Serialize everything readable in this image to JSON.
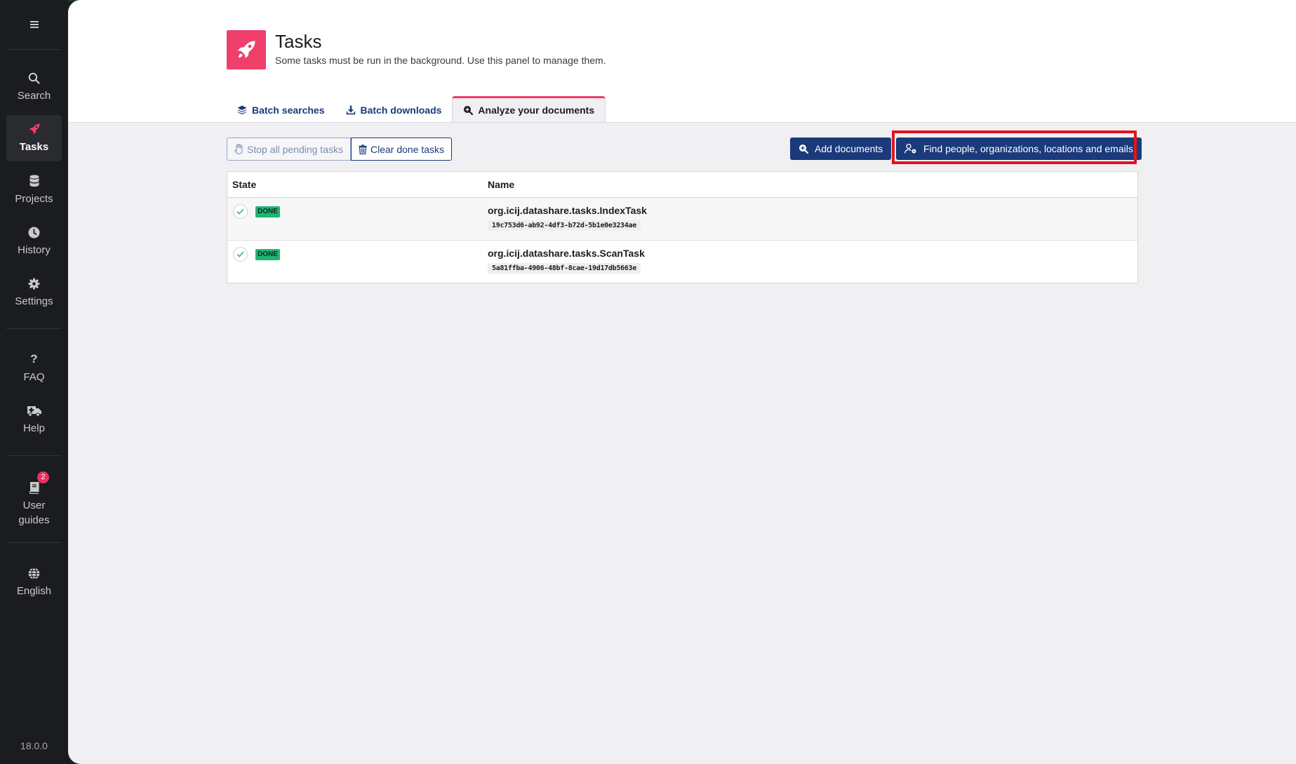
{
  "sidebar": {
    "menu_icon": "hamburger-icon",
    "items": [
      {
        "label": "Search",
        "icon": "search-icon"
      },
      {
        "label": "Tasks",
        "icon": "rocket-icon",
        "active": true
      },
      {
        "label": "Projects",
        "icon": "database-icon"
      },
      {
        "label": "History",
        "icon": "clock-icon"
      },
      {
        "label": "Settings",
        "icon": "gear-icon"
      },
      {
        "label": "FAQ",
        "icon": "question-icon"
      },
      {
        "label": "Help",
        "icon": "ambulance-icon"
      },
      {
        "label": "User guides",
        "icon": "book-icon",
        "badge": "2"
      },
      {
        "label": "English",
        "icon": "globe-icon"
      }
    ],
    "version": "18.0.0"
  },
  "header": {
    "title": "Tasks",
    "subtitle": "Some tasks must be run in the background. Use this panel to manage them."
  },
  "tabs": [
    {
      "label": "Batch searches",
      "icon": "layers-icon"
    },
    {
      "label": "Batch downloads",
      "icon": "download-icon"
    },
    {
      "label": "Analyze your documents",
      "icon": "search-plus-icon",
      "active": true
    }
  ],
  "toolbar": {
    "stop_label": "Stop all pending tasks",
    "clear_label": "Clear done tasks",
    "add_label": "Add documents",
    "find_label": "Find people, organizations, locations and emails"
  },
  "table": {
    "headers": {
      "state": "State",
      "name": "Name"
    },
    "rows": [
      {
        "state": "DONE",
        "name": "org.icij.datashare.tasks.IndexTask",
        "id": "19c753d6-ab92-4df3-b72d-5b1e0e3234ae"
      },
      {
        "state": "DONE",
        "name": "org.icij.datashare.tasks.ScanTask",
        "id": "5a81ffba-4906-48bf-8cae-19d17db5663e"
      }
    ]
  },
  "colors": {
    "accent": "#ef3f6b",
    "primary": "#1a3a7c",
    "success": "#22b473",
    "highlight": "#e0161f"
  }
}
